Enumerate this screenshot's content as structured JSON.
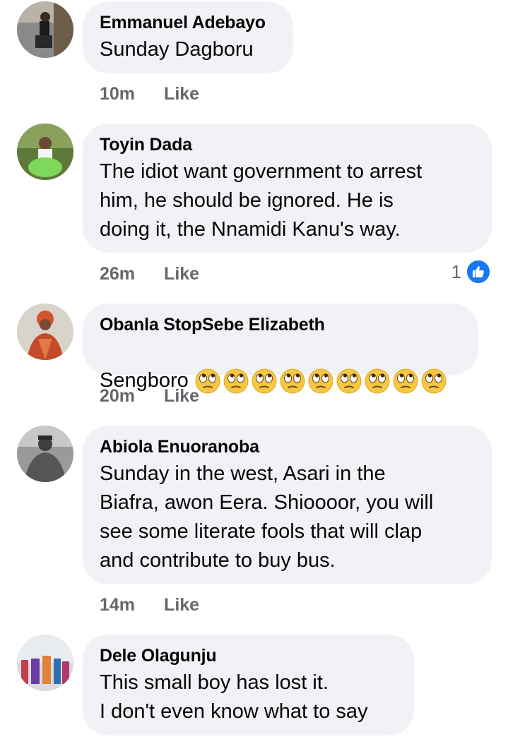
{
  "comments": [
    {
      "author": "Emmanuel Adebayo",
      "text": "Sunday Dagboru",
      "time": "10m",
      "like_label": "Like"
    },
    {
      "author": "Toyin Dada",
      "text": "The idiot want government to arrest\nhim, he should be ignored. He is\ndoing it, the Nnamidi Kanu's way.",
      "time": "26m",
      "like_label": "Like",
      "reaction_count": "1"
    },
    {
      "author": "Obanla StopSebe Elizabeth",
      "text": "Sengboro",
      "emoji_count": 9,
      "emoji": "face-with-rolling-eyes",
      "time": "20m",
      "like_label": "Like"
    },
    {
      "author": "Abiola Enuoranoba",
      "text": "Sunday in the west, Asari in the\nBiafra, awon Eera. Shioooor, you will\nsee some literate fools that will clap\nand contribute to buy bus.",
      "time": "14m",
      "like_label": "Like"
    },
    {
      "author": "Dele Olagunju",
      "text": "This small boy has lost it.\nI don't even know what to say"
    }
  ],
  "colors": {
    "bubble": "#f0f2f5",
    "meta": "#65676b",
    "like_badge": "#1877f2"
  }
}
